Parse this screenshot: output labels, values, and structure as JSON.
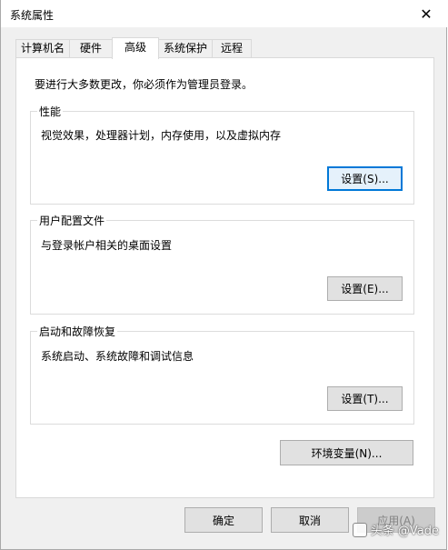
{
  "window": {
    "title": "系统属性"
  },
  "tabs": [
    {
      "label": "计算机名"
    },
    {
      "label": "硬件"
    },
    {
      "label": "高级"
    },
    {
      "label": "系统保护"
    },
    {
      "label": "远程"
    }
  ],
  "notice": "要进行大多数更改，你必须作为管理员登录。",
  "performance": {
    "title": "性能",
    "desc": "视觉效果，处理器计划，内存使用，以及虚拟内存",
    "button": "设置(S)..."
  },
  "profiles": {
    "title": "用户配置文件",
    "desc": "与登录帐户相关的桌面设置",
    "button": "设置(E)..."
  },
  "startup": {
    "title": "启动和故障恢复",
    "desc": "系统启动、系统故障和调试信息",
    "button": "设置(T)..."
  },
  "env_button": "环境变量(N)...",
  "footer": {
    "ok": "确定",
    "cancel": "取消",
    "apply": "应用(A)"
  },
  "watermark": "头条 @Vade"
}
